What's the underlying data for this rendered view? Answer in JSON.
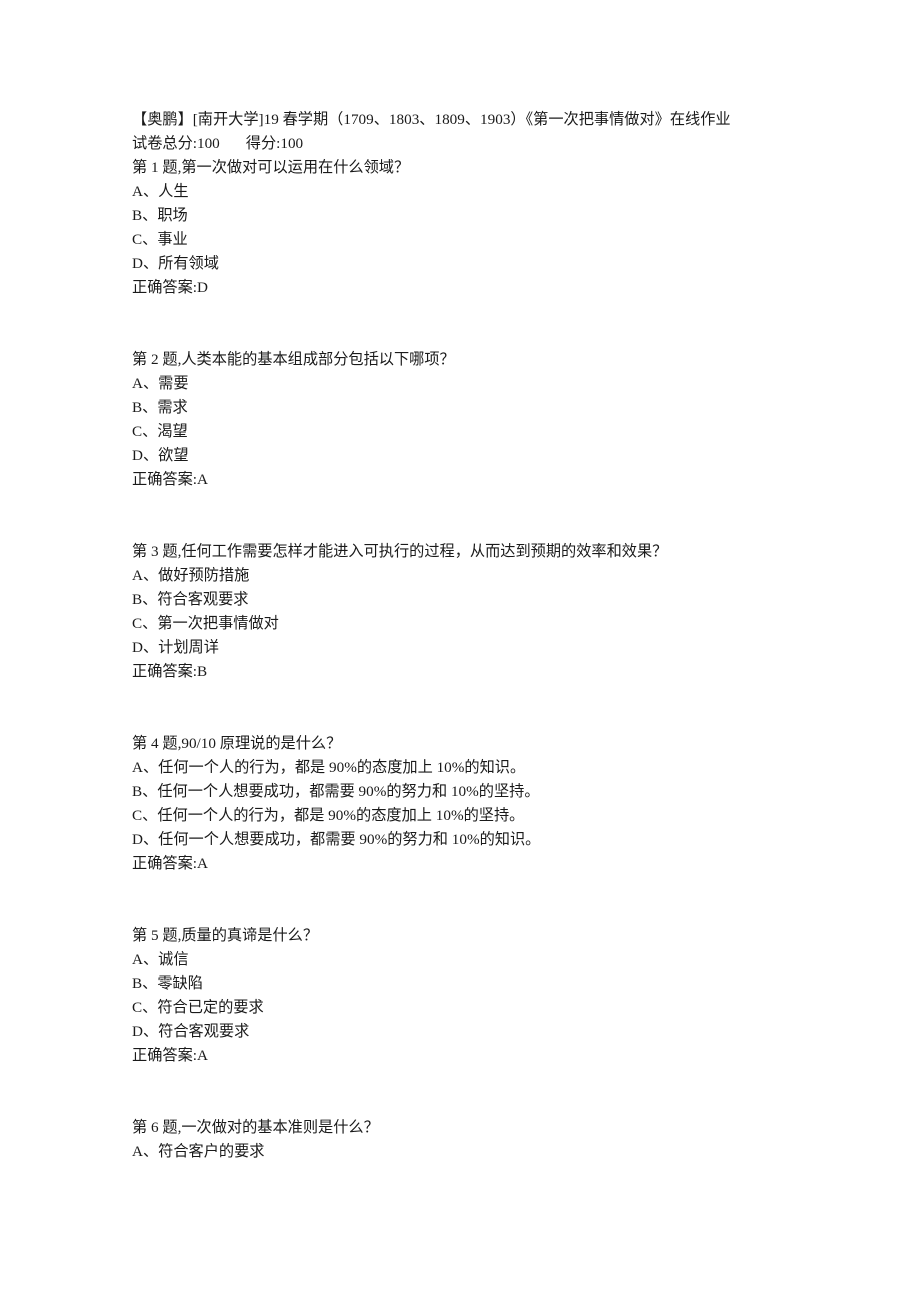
{
  "document": {
    "header": {
      "title": "【奥鹏】[南开大学]19 春学期（1709、1803、1809、1903）《第一次把事情做对》在线作业",
      "total_score_label": "试卷总分:100",
      "obtained_score_label": "得分:100"
    },
    "questions": [
      {
        "stem": "第 1 题,第一次做对可以运用在什么领域？",
        "options": [
          "A、人生",
          "B、职场",
          "C、事业",
          "D、所有领域"
        ],
        "answer": "正确答案:D"
      },
      {
        "stem": "第 2 题,人类本能的基本组成部分包括以下哪项？",
        "options": [
          "A、需要",
          "B、需求",
          "C、渴望",
          "D、欲望"
        ],
        "answer": "正确答案:A"
      },
      {
        "stem": "第 3 题,任何工作需要怎样才能进入可执行的过程，从而达到预期的效率和效果？",
        "options": [
          "A、做好预防措施",
          "B、符合客观要求",
          "C、第一次把事情做对",
          "D、计划周详"
        ],
        "answer": "正确答案:B"
      },
      {
        "stem": "第 4 题,90/10 原理说的是什么？",
        "options": [
          "A、任何一个人的行为，都是 90%的态度加上 10%的知识。",
          "B、任何一个人想要成功，都需要 90%的努力和 10%的坚持。",
          "C、任何一个人的行为，都是 90%的态度加上 10%的坚持。",
          "D、任何一个人想要成功，都需要 90%的努力和 10%的知识。"
        ],
        "answer": "正确答案:A"
      },
      {
        "stem": "第 5 题,质量的真谛是什么？",
        "options": [
          "A、诚信",
          "B、零缺陷",
          "C、符合已定的要求",
          "D、符合客观要求"
        ],
        "answer": "正确答案:A"
      },
      {
        "stem": "第 6 题,一次做对的基本准则是什么？",
        "options": [
          "A、符合客户的要求"
        ],
        "answer": ""
      }
    ]
  }
}
